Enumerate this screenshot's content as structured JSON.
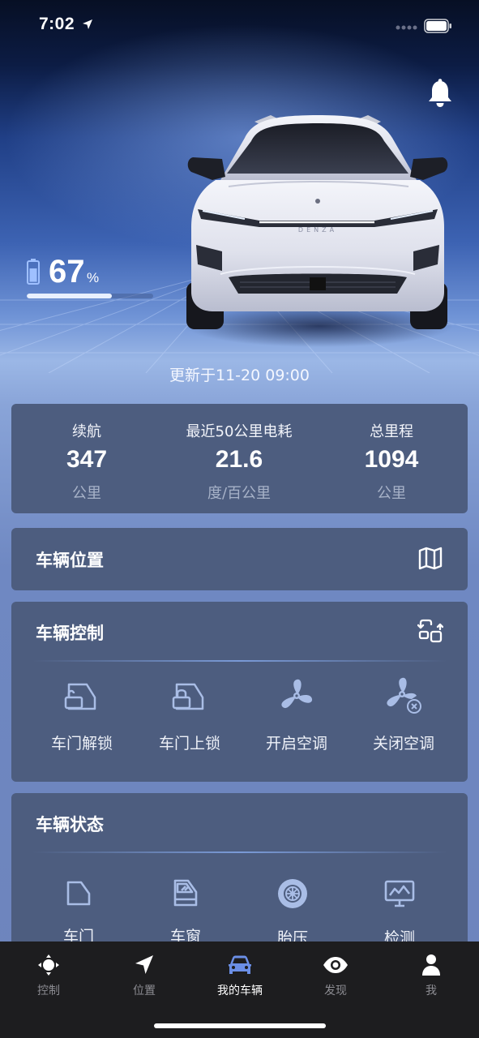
{
  "status_bar": {
    "time": "7:02"
  },
  "battery": {
    "value": "67",
    "unit": "%",
    "level": 0.67
  },
  "updated_text": "更新于11-20 09:00",
  "stats": [
    {
      "label": "续航",
      "value": "347",
      "unit": "公里"
    },
    {
      "label": "最近50公里电耗",
      "value": "21.6",
      "unit": "度/百公里"
    },
    {
      "label": "总里程",
      "value": "1094",
      "unit": "公里"
    }
  ],
  "location_card": {
    "title": "车辆位置",
    "icon": "map-icon"
  },
  "control_card": {
    "title": "车辆控制",
    "icon": "switch-icon",
    "actions": [
      {
        "label": "车门解锁",
        "icon": "door-unlock-icon"
      },
      {
        "label": "车门上锁",
        "icon": "door-lock-icon"
      },
      {
        "label": "开启空调",
        "icon": "fan-icon"
      },
      {
        "label": "关闭空调",
        "icon": "fan-off-icon"
      }
    ]
  },
  "status_card": {
    "title": "车辆状态",
    "items": [
      {
        "label": "车门",
        "icon": "door-icon"
      },
      {
        "label": "车窗",
        "icon": "window-icon"
      },
      {
        "label": "胎压",
        "icon": "tire-icon"
      },
      {
        "label": "检测",
        "icon": "monitor-icon"
      }
    ]
  },
  "tabbar": {
    "active_color": "#6b8fe6",
    "tabs": [
      {
        "label": "控制",
        "icon": "control-icon"
      },
      {
        "label": "位置",
        "icon": "location-arrow-icon"
      },
      {
        "label": "我的车辆",
        "icon": "car-icon",
        "active": true
      },
      {
        "label": "发现",
        "icon": "eye-icon"
      },
      {
        "label": "我",
        "icon": "user-icon"
      }
    ]
  }
}
